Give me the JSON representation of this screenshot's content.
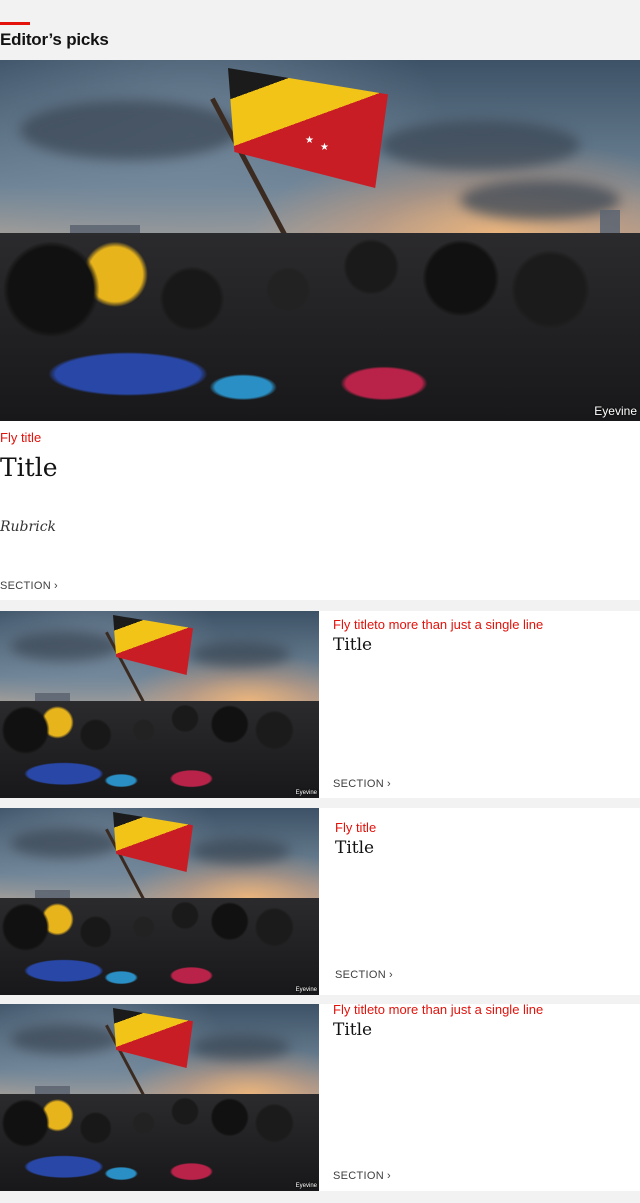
{
  "header": {
    "title": "Editor’s picks"
  },
  "colors": {
    "accent": "#e3120b",
    "background": "#f2f2f2"
  },
  "hero": {
    "image_credit": "Eyevine",
    "fly_title": "Fly title",
    "title": "Title",
    "rubric": "Rubrick",
    "section": "SECTION",
    "chevron": "›"
  },
  "cards": [
    {
      "image_credit": "Eyevine",
      "fly_title": "Fly titleto more than just a single line",
      "title": "Title",
      "section": "SECTION",
      "chevron": "›"
    },
    {
      "image_credit": "Eyevine",
      "fly_title": "Fly title",
      "title": "Title",
      "section": "SECTION",
      "chevron": "›"
    },
    {
      "image_credit": "Eyevine",
      "fly_title": "Fly titleto more than just a single line",
      "title": "Title",
      "section": "SECTION",
      "chevron": "›"
    }
  ]
}
